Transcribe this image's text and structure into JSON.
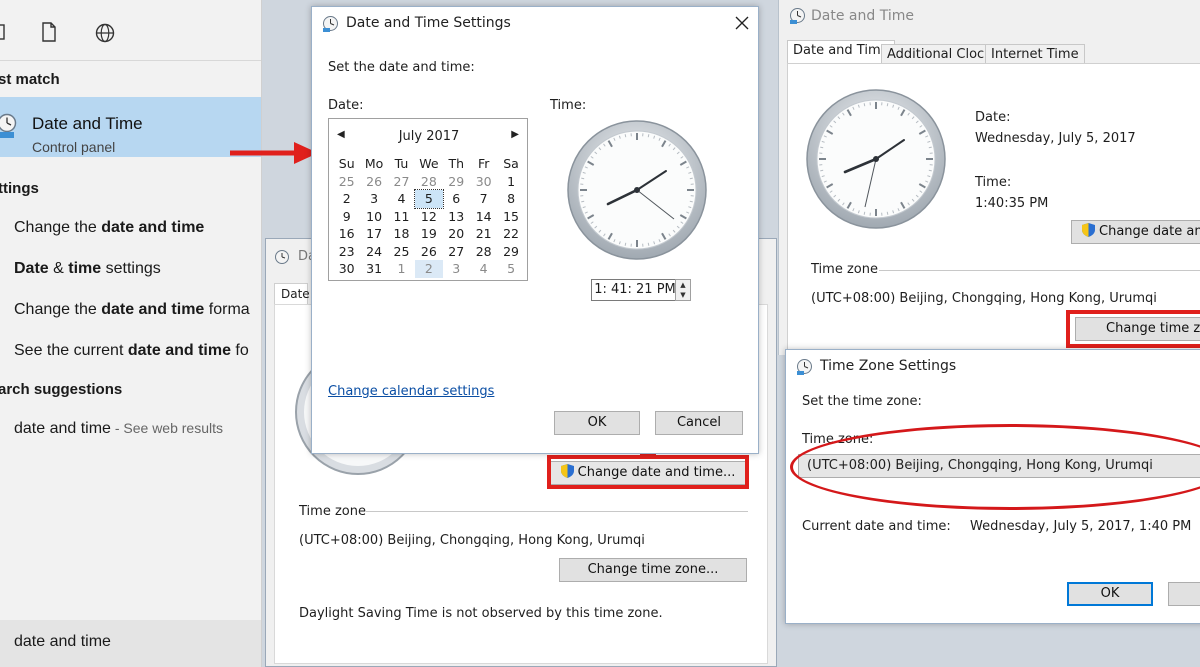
{
  "search": {
    "best_match_header": "st match",
    "best_match": {
      "title": "Date and Time",
      "subtitle": "Control panel"
    },
    "settings_header": "ttings",
    "settings_items": [
      {
        "pre": "Change the ",
        "bold": "date and time",
        "post": ""
      },
      {
        "pre": "",
        "bold": "Date",
        "post": " & ",
        "bold2": "time",
        "post2": " settings"
      },
      {
        "pre": "Change the ",
        "bold": "date and time",
        "post": " forma"
      },
      {
        "pre": "See the current ",
        "bold": "date and time",
        "post": " fo"
      }
    ],
    "suggestions_header": "arch suggestions",
    "web_item": {
      "text": "date and time",
      "muted": " - See web results"
    },
    "query": "date and time",
    "icons": [
      "document-icon",
      "globe-icon"
    ]
  },
  "dt_back": {
    "title": "Da",
    "tab": "Date",
    "change_datetime_button": "Change date and time...",
    "timezone_label": "Time zone",
    "timezone_value": "(UTC+08:00) Beijing, Chongqing, Hong Kong, Urumqi",
    "change_timezone_button": "Change time zone...",
    "dst_note": "Daylight Saving Time is not observed by this time zone."
  },
  "dts": {
    "title": "Date and Time Settings",
    "instruction": "Set the date and time:",
    "date_label": "Date:",
    "time_label": "Time:",
    "calendar": {
      "month": "July 2017",
      "weekdays": [
        "Su",
        "Mo",
        "Tu",
        "We",
        "Th",
        "Fr",
        "Sa"
      ],
      "weeks": [
        [
          "25",
          "26",
          "27",
          "28",
          "29",
          "30",
          "1"
        ],
        [
          "2",
          "3",
          "4",
          "5",
          "6",
          "7",
          "8"
        ],
        [
          "9",
          "10",
          "11",
          "12",
          "13",
          "14",
          "15"
        ],
        [
          "16",
          "17",
          "18",
          "19",
          "20",
          "21",
          "22"
        ],
        [
          "23",
          "24",
          "25",
          "26",
          "27",
          "28",
          "29"
        ],
        [
          "30",
          "31",
          "1",
          "2",
          "3",
          "4",
          "5"
        ]
      ],
      "selected_day": "5"
    },
    "time_value": "1: 41: 21 PM",
    "calendar_link": "Change calendar settings",
    "ok": "OK",
    "cancel": "Cancel"
  },
  "dt_right": {
    "title": "Date and Time",
    "tabs": [
      "Date and Time",
      "Additional Clocks",
      "Internet Time"
    ],
    "date_label": "Date:",
    "date_value": "Wednesday, July 5, 2017",
    "time_label": "Time:",
    "time_value": "1:40:35 PM",
    "change_datetime_button": "Change date and",
    "timezone_label": "Time zone",
    "timezone_value": "(UTC+08:00) Beijing, Chongqing, Hong Kong, Urumqi",
    "change_timezone_button": "Change time zo"
  },
  "tzs": {
    "title": "Time Zone Settings",
    "instruction": "Set the time zone:",
    "timezone_label": "Time zone:",
    "timezone_value": "(UTC+08:00) Beijing, Chongqing, Hong Kong, Urumqi",
    "current_label": "Current date and time:",
    "current_value": "Wednesday, July 5, 2017, 1:40 PM",
    "ok": "OK"
  },
  "colors": {
    "highlight_red": "#e0201c",
    "best_match_bg": "#b7d7f1",
    "link_blue": "#0a4ea4",
    "focus_blue": "#0078d7"
  }
}
